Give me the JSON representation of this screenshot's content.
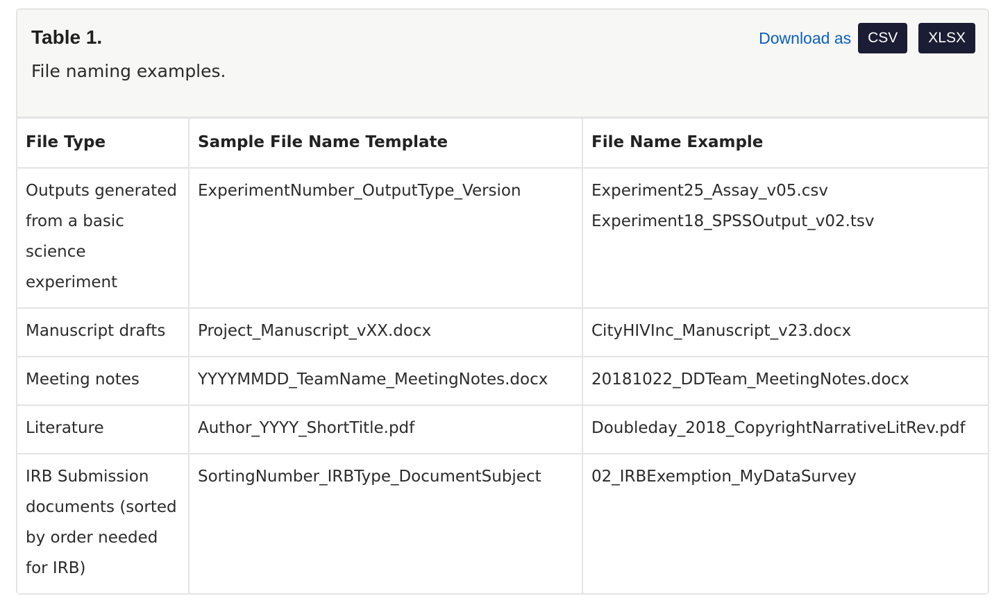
{
  "caption": {
    "title": "Table 1.",
    "text": "File naming examples."
  },
  "download": {
    "label": "Download as",
    "buttons": [
      "CSV",
      "XLSX"
    ]
  },
  "colors": {
    "link": "#0a5fbf",
    "button_bg": "#1a1d33",
    "caption_bg": "#f7f7f5",
    "border": "#e4e4e4"
  },
  "table": {
    "headers": [
      "File Type",
      "Sample File Name Template",
      "File Name Example"
    ],
    "rows": [
      {
        "file_type": "Outputs generated from a basic science experiment",
        "template": "ExperimentNumber_OutputType_Version",
        "examples": [
          "Experiment25_Assay_v05.csv",
          "Experiment18_SPSSOutput_v02.tsv"
        ]
      },
      {
        "file_type": "Manuscript drafts",
        "template": "Project_Manuscript_vXX.docx",
        "examples": [
          "CityHIVInc_Manuscript_v23.docx"
        ]
      },
      {
        "file_type": "Meeting notes",
        "template": "YYYYMMDD_TeamName_MeetingNotes.docx",
        "examples": [
          "20181022_DDTeam_MeetingNotes.docx"
        ]
      },
      {
        "file_type": "Literature",
        "template": "Author_YYYY_ShortTitle.pdf",
        "examples": [
          "Doubleday_2018_CopyrightNarrativeLitRev.pdf"
        ]
      },
      {
        "file_type": "IRB Submission documents (sorted by order needed for IRB)",
        "template": "SortingNumber_IRBType_DocumentSubject",
        "examples": [
          "02_IRBExemption_MyDataSurvey"
        ]
      }
    ]
  }
}
